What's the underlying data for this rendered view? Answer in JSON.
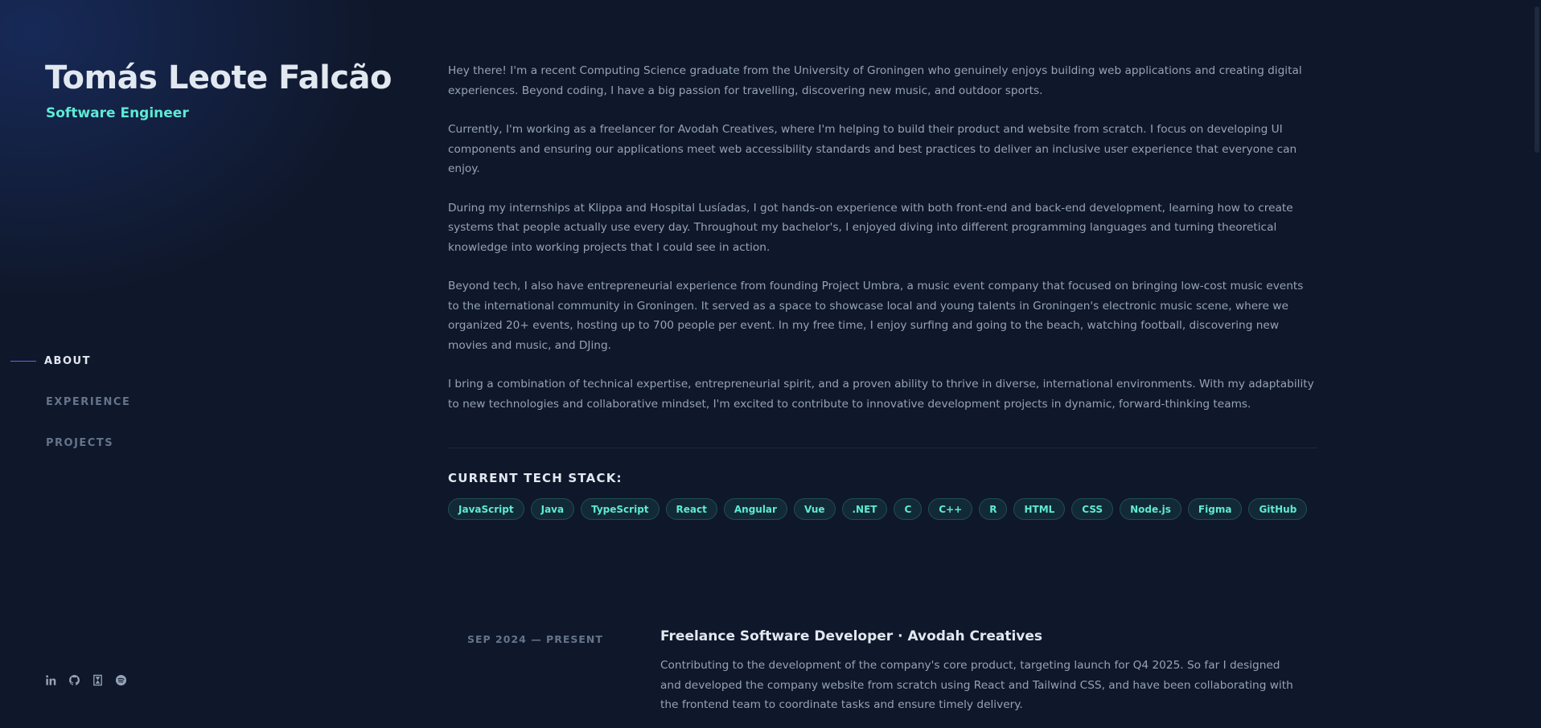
{
  "header": {
    "name": "Tomás Leote Falcão",
    "role": "Software Engineer"
  },
  "nav": {
    "items": [
      {
        "label": "ABOUT",
        "active": true
      },
      {
        "label": "EXPERIENCE",
        "active": false
      },
      {
        "label": "PROJECTS",
        "active": false
      }
    ]
  },
  "socials": [
    {
      "icon": "linkedin-icon"
    },
    {
      "icon": "github-icon"
    },
    {
      "icon": "hourglass-icon"
    },
    {
      "icon": "spotify-icon"
    }
  ],
  "about": {
    "paragraphs": [
      "Hey there! I'm a recent Computing Science graduate from the University of Groningen who genuinely enjoys building web applications and creating digital experiences. Beyond coding, I have a big passion for travelling, discovering new music, and outdoor sports.",
      "Currently, I'm working as a freelancer for Avodah Creatives, where I'm helping to build their product and website from scratch. I focus on developing UI components and ensuring our applications meet web accessibility standards and best practices to deliver an inclusive user experience that everyone can enjoy.",
      "During my internships at Klippa and Hospital Lusíadas, I got hands-on experience with both front-end and back-end development, learning how to create systems that people actually use every day. Throughout my bachelor's, I enjoyed diving into different programming languages and turning theoretical knowledge into working projects that I could see in action.",
      "Beyond tech, I also have entrepreneurial experience from founding Project Umbra, a music event company that focused on bringing low-cost music events to the international community in Groningen. It served as a space to showcase local and young talents in Groningen's electronic music scene, where we organized 20+ events, hosting up to 700 people per event. In my free time, I enjoy surfing and going to the beach, watching football, discovering new movies and music, and DJing.",
      "I bring a combination of technical expertise, entrepreneurial spirit, and a proven ability to thrive in diverse, international environments. With my adaptability to new technologies and collaborative mindset, I'm excited to contribute to innovative development projects in dynamic, forward-thinking teams."
    ]
  },
  "tech_stack": {
    "title": "CURRENT TECH STACK:",
    "items": [
      "JavaScript",
      "Java",
      "TypeScript",
      "React",
      "Angular",
      "Vue",
      ".NET",
      "C",
      "C++",
      "R",
      "HTML",
      "CSS",
      "Node.js",
      "Figma",
      "GitHub"
    ]
  },
  "experience": [
    {
      "date": "SEP 2024 — PRESENT",
      "title": "Freelance Software Developer · Avodah Creatives",
      "description": "Contributing to the development of the company's core product, targeting launch for Q4 2025. So far I designed and developed the company website from scratch using React and Tailwind CSS, and have been collaborating with the frontend team to coordinate tasks and ensure timely delivery."
    }
  ],
  "colors": {
    "background": "#0f172a",
    "accent": "#5eead4",
    "text": "#e2e8f0",
    "muted": "#94a3b8",
    "nav_active_line": "#6366f1"
  }
}
